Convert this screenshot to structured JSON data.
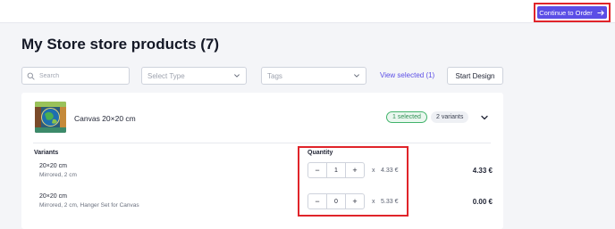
{
  "header": {
    "continue_label": "Continue to Order",
    "accent_color": "#5b4ee6"
  },
  "page": {
    "title": "My Store store products (7)"
  },
  "filters": {
    "search_placeholder": "Search",
    "type_placeholder": "Select Type",
    "tags_placeholder": "Tags",
    "view_selected": "View selected (1)",
    "start_design": "Start Design"
  },
  "product": {
    "name": "Canvas 20×20 cm",
    "selected_badge": "1 selected",
    "variants_badge": "2 variants",
    "variants_header": "Variants",
    "quantity_header": "Quantity",
    "variants": [
      {
        "name": "20×20 cm",
        "options": "Mirrored, 2 cm",
        "quantity": "1",
        "times": "x",
        "unit_price": "4.33 €",
        "total": "4.33 €"
      },
      {
        "name": "20×20 cm",
        "options": "Mirrored, 2 cm, Hanger Set for Canvas",
        "quantity": "0",
        "times": "x",
        "unit_price": "5.33 €",
        "total": "0.00 €"
      }
    ]
  },
  "icons": {
    "continue": "arrow-right-icon",
    "search": "search-icon",
    "dropdown": "chevron-down-icon",
    "expand": "chevron-down-icon",
    "decrement": "minus",
    "increment": "plus"
  }
}
